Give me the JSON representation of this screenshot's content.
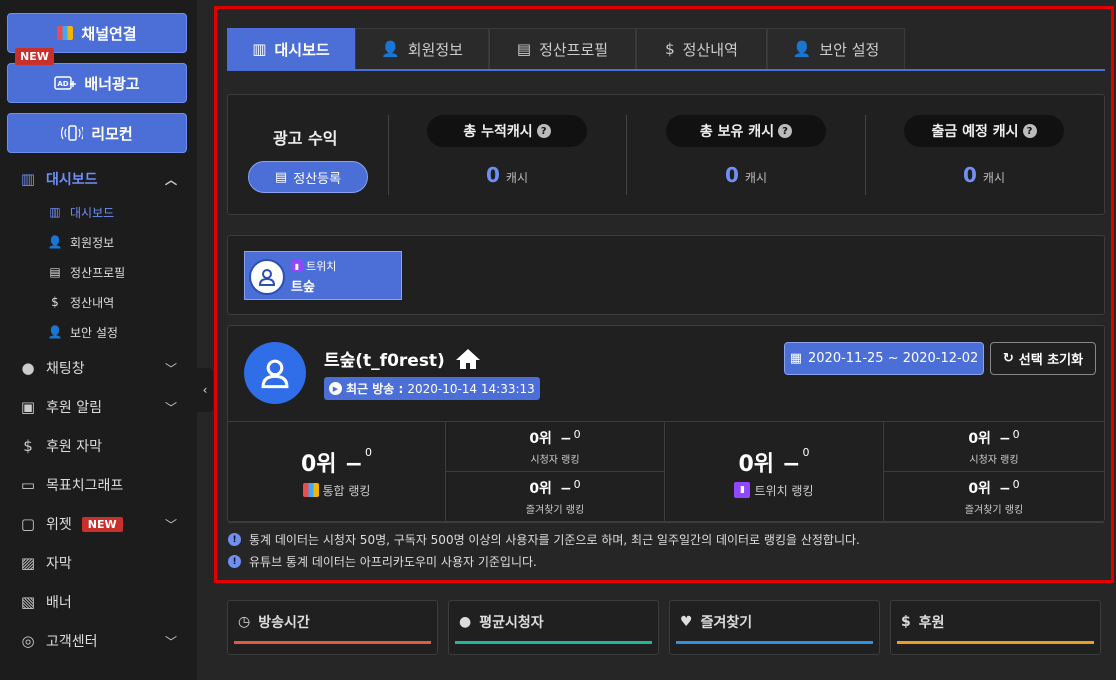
{
  "sidebar": {
    "buttons": [
      {
        "label": "채널연결",
        "icon": "multi-platform-icon"
      },
      {
        "label": "배너광고",
        "icon": "ad-icon"
      },
      {
        "label": "리모컨",
        "icon": "remote-icon"
      }
    ],
    "new_flag": "NEW",
    "dashboard": {
      "label": "대시보드",
      "sub_items": [
        {
          "label": "대시보드",
          "icon": "chart-icon"
        },
        {
          "label": "회원정보",
          "icon": "user-edit-icon"
        },
        {
          "label": "정산프로필",
          "icon": "id-card-icon"
        },
        {
          "label": "정산내역",
          "icon": "payout-icon"
        },
        {
          "label": "보안 설정",
          "icon": "user-shield-icon"
        }
      ]
    },
    "menu": [
      {
        "label": "채팅창",
        "icon": "chat-icon",
        "chevron": true
      },
      {
        "label": "후원 알림",
        "icon": "gift-icon",
        "chevron": true
      },
      {
        "label": "후원 자막",
        "icon": "caption-icon",
        "chevron": false
      },
      {
        "label": "목표치그래프",
        "icon": "battery-icon",
        "chevron": false
      },
      {
        "label": "위젯",
        "icon": "widget-icon",
        "chevron": true,
        "badge": "NEW"
      },
      {
        "label": "자막",
        "icon": "image-text-icon",
        "chevron": false
      },
      {
        "label": "배너",
        "icon": "image-icon",
        "chevron": false
      },
      {
        "label": "고객센터",
        "icon": "headset-icon",
        "chevron": true
      }
    ]
  },
  "tabs": [
    {
      "label": "대시보드",
      "active": true
    },
    {
      "label": "회원정보",
      "active": false
    },
    {
      "label": "정산프로필",
      "active": false
    },
    {
      "label": "정산내역",
      "active": false
    },
    {
      "label": "보안 설정",
      "active": false
    }
  ],
  "revenue": {
    "title": "광고 수익",
    "register_button": "정산등록",
    "cash": [
      {
        "label": "총 누적캐시",
        "value": "0",
        "unit": "캐시"
      },
      {
        "label": "총 보유 캐시",
        "value": "0",
        "unit": "캐시"
      },
      {
        "label": "출금 예정 캐시",
        "value": "0",
        "unit": "캐시"
      }
    ]
  },
  "channel_card": {
    "platform": "트위치",
    "name": "트숲"
  },
  "channel_detail": {
    "title": "트숲(t_f0rest)",
    "last_broadcast_label": "최근 방송 :",
    "last_broadcast_value": "2020-10-14 14:33:13",
    "date_range": "2020-11-25 ~ 2020-12-02",
    "reset_button": "선택 초기화"
  },
  "rankings": {
    "left": {
      "main": {
        "rank": "0위",
        "dash": "−",
        "change": "0",
        "label": "통합 랭킹"
      },
      "viewer": {
        "rank": "0위",
        "dash": "−",
        "change": "0",
        "label": "시청자 랭킹"
      },
      "favorite": {
        "rank": "0위",
        "dash": "−",
        "change": "0",
        "label": "즐겨찾기 랭킹"
      }
    },
    "right": {
      "main": {
        "rank": "0위",
        "dash": "−",
        "change": "0",
        "label": "트위치 랭킹"
      },
      "viewer": {
        "rank": "0위",
        "dash": "−",
        "change": "0",
        "label": "시청자 랭킹"
      },
      "favorite": {
        "rank": "0위",
        "dash": "−",
        "change": "0",
        "label": "즐겨찾기 랭킹"
      }
    }
  },
  "notices": [
    "통계 데이터는 시청자 50명, 구독자 500명 이상의 사용자를 기준으로 하며, 최근 일주일간의 데이터로 랭킹을 산정합니다.",
    "유튜브 통계 데이터는 아프리카도우미 사용자 기준입니다."
  ],
  "stats": [
    {
      "label": "방송시간",
      "icon": "clock-icon",
      "color": "#e05a47"
    },
    {
      "label": "평균시청자",
      "icon": "user-icon",
      "color": "#1fb89a"
    },
    {
      "label": "즐겨찾기",
      "icon": "heart-icon",
      "color": "#2f8fe0"
    },
    {
      "label": "후원",
      "icon": "donation-icon",
      "color": "#e8a020"
    }
  ],
  "colors": {
    "accent": "#4b6fd6",
    "highlight": "#e00000",
    "new_badge": "#c9302c"
  }
}
